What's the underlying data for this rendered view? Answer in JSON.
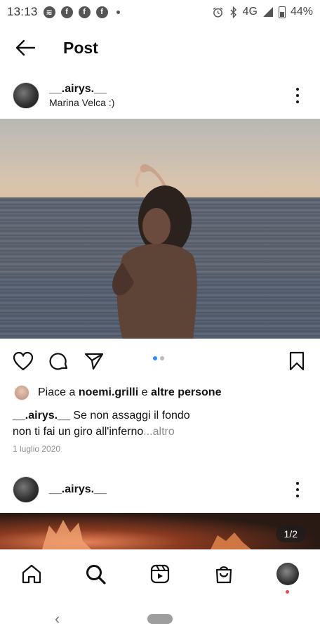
{
  "status_bar": {
    "time": "13:13",
    "network": "4G",
    "battery": "44%",
    "notification_icons": [
      "spotify-icon",
      "facebook-icon",
      "facebook-icon",
      "facebook-icon"
    ]
  },
  "header": {
    "title": "Post"
  },
  "post": {
    "username": "__.airys.__",
    "location": "Marina Velca :)",
    "likes": {
      "prefix": "Piace a",
      "user": "noemi.grilli",
      "connector": "e",
      "others": "altre persone"
    },
    "caption": {
      "username": "__.airys.__",
      "line1": "Se non assaggi il fondo",
      "line2": "non ti fai un giro all'inferno",
      "more": "...altro"
    },
    "date": "1 luglio 2020",
    "carousel_dots": 2,
    "carousel_active": 1
  },
  "next_post": {
    "username": "__.airys.__",
    "counter": "1/2"
  },
  "colors": {
    "accent_blue": "#2d8cff",
    "notification_red": "#ed4956",
    "muted_text": "#8e8e8e"
  }
}
